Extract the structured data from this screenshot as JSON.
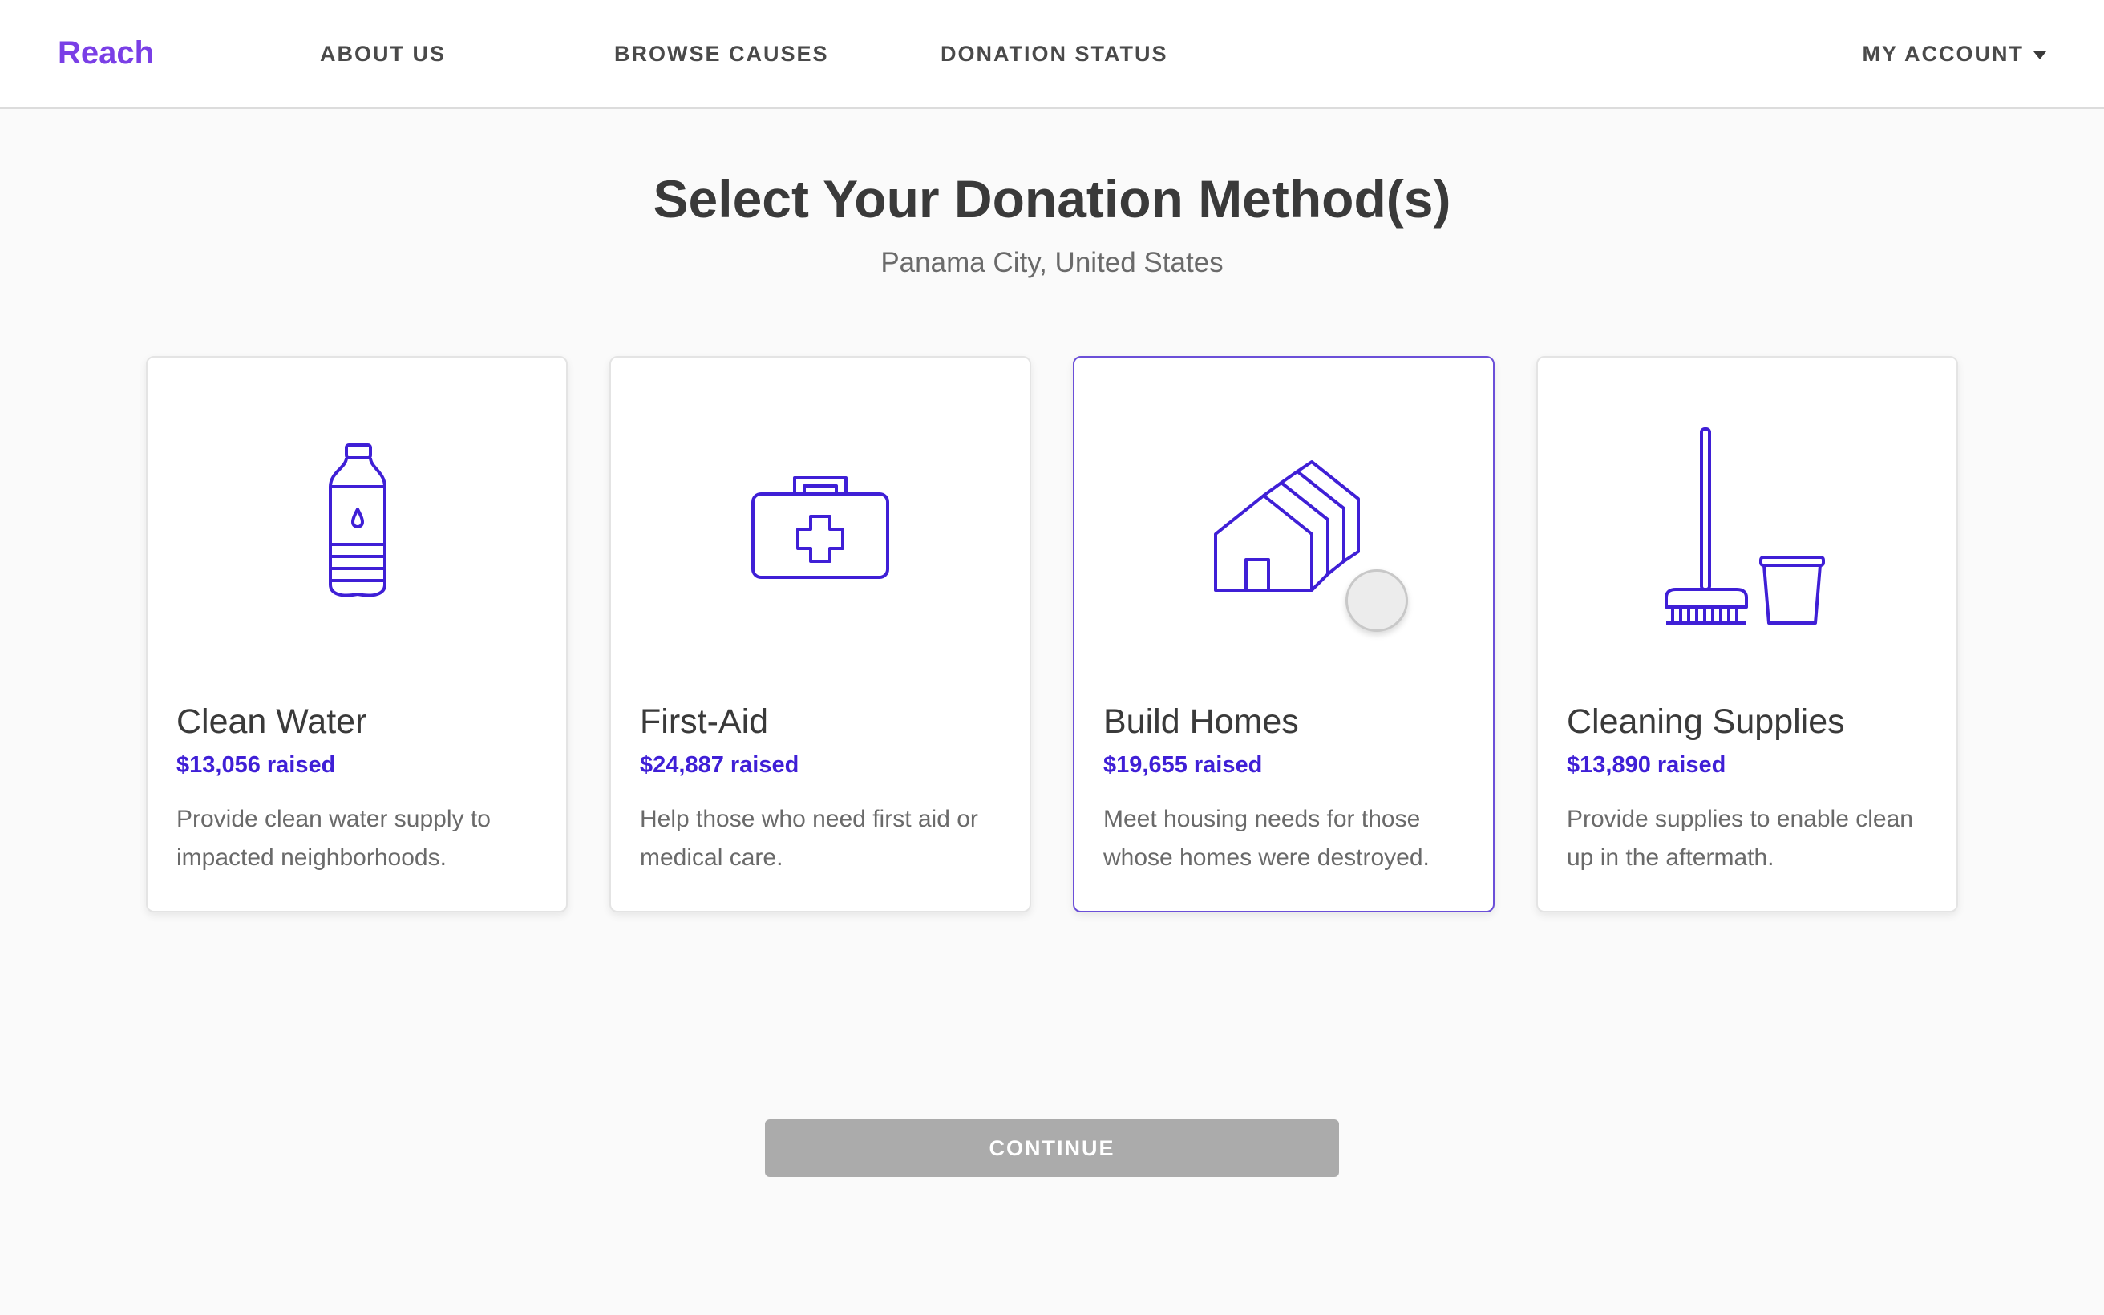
{
  "header": {
    "logo": "Reach",
    "nav": {
      "about": "ABOUT US",
      "browse": "BROWSE CAUSES",
      "status": "DONATION STATUS"
    },
    "account": "MY ACCOUNT"
  },
  "main": {
    "title": "Select Your Donation Method(s)",
    "subtitle": "Panama City, United States",
    "cards": [
      {
        "icon": "water-bottle-icon",
        "title": "Clean Water",
        "raised": "$13,056 raised",
        "description": "Provide clean water supply to impacted neighborhoods."
      },
      {
        "icon": "first-aid-kit-icon",
        "title": "First-Aid",
        "raised": "$24,887 raised",
        "description": "Help those who need first aid or medical care."
      },
      {
        "icon": "houses-icon",
        "title": "Build Homes",
        "raised": "$19,655 raised",
        "description": "Meet housing needs for those whose homes were destroyed."
      },
      {
        "icon": "broom-bucket-icon",
        "title": "Cleaning Supplies",
        "raised": "$13,890 raised",
        "description": "Provide supplies to enable clean up in the aftermath."
      }
    ],
    "continue_label": "CONTINUE"
  },
  "colors": {
    "brand": "#7a3fe6",
    "accent": "#3f1fd6",
    "selected_border": "#6b4fd8",
    "button_disabled": "#ababab"
  }
}
